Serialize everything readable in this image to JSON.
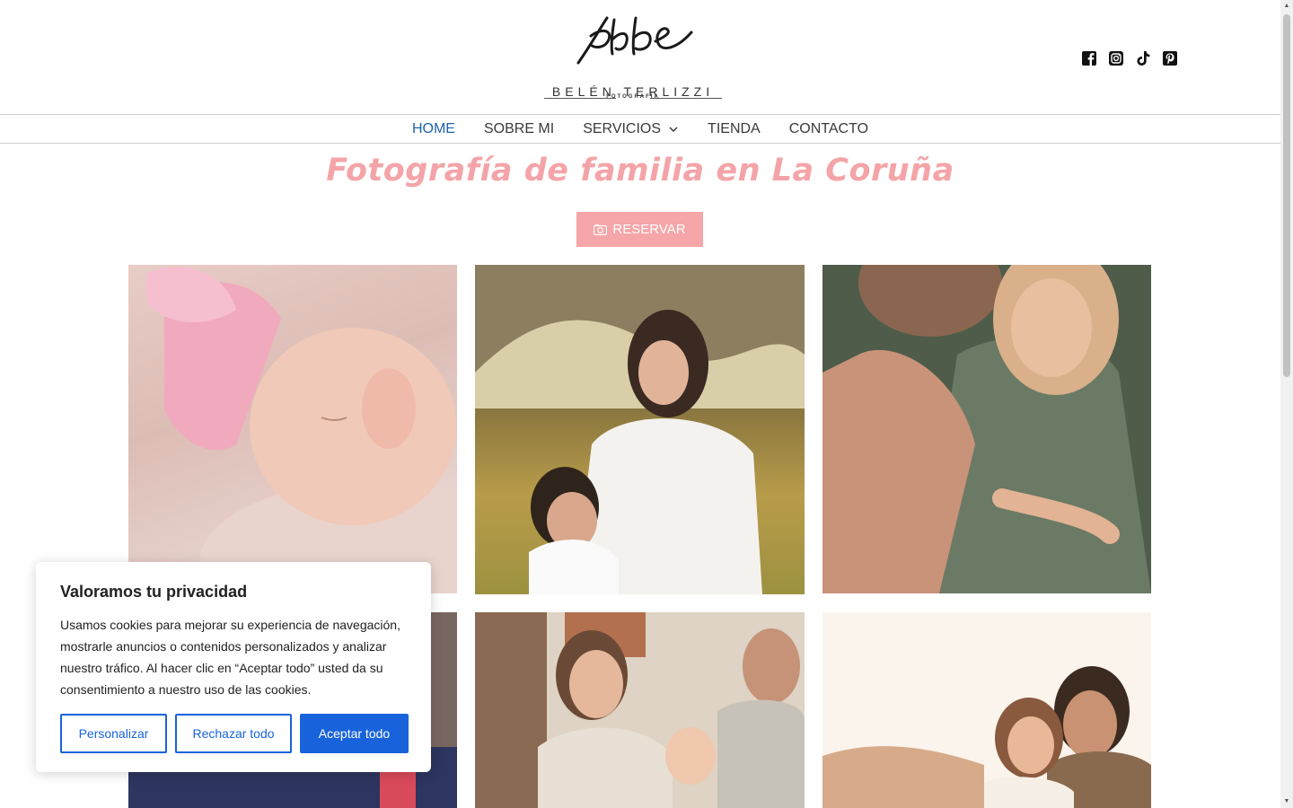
{
  "brand": {
    "script_name": "phbe",
    "name": "BELÉN TERLIZZI",
    "tagline": "FOTOGRAFÍA"
  },
  "social": [
    {
      "icon": "facebook-icon"
    },
    {
      "icon": "instagram-icon"
    },
    {
      "icon": "tiktok-icon"
    },
    {
      "icon": "pinterest-icon"
    }
  ],
  "nav": {
    "items": [
      {
        "label": "HOME",
        "active": true
      },
      {
        "label": "SOBRE MI"
      },
      {
        "label": "SERVICIOS",
        "has_dropdown": true
      },
      {
        "label": "TIENDA"
      },
      {
        "label": "CONTACTO"
      }
    ]
  },
  "hero": {
    "title": "Fotografía de familia en La Coruña",
    "button_label": "RESERVAR",
    "button_icon": "camera-icon"
  },
  "gallery": {
    "photos": [
      {
        "subject": "newborn baby sleeping with pink bow"
      },
      {
        "subject": "pregnant mother with young son outdoors"
      },
      {
        "subject": "pregnant couple embracing"
      },
      {
        "subject": "wedding guests"
      },
      {
        "subject": "family with baby at baptism"
      },
      {
        "subject": "wedding couple at sunset"
      }
    ]
  },
  "cookie_banner": {
    "title": "Valoramos tu privacidad",
    "text": "Usamos cookies para mejorar su experiencia de navegación, mostrarle anuncios o contenidos personalizados y analizar nuestro tráfico. Al hacer clic en “Aceptar todo” usted da su consentimiento a nuestro uso de las cookies.",
    "customize_label": "Personalizar",
    "reject_label": "Rechazar todo",
    "accept_label": "Aceptar todo"
  },
  "colors": {
    "accent_pink": "#f6a5a8",
    "nav_active": "#1e62ac",
    "cookie_blue": "#1863dc"
  }
}
